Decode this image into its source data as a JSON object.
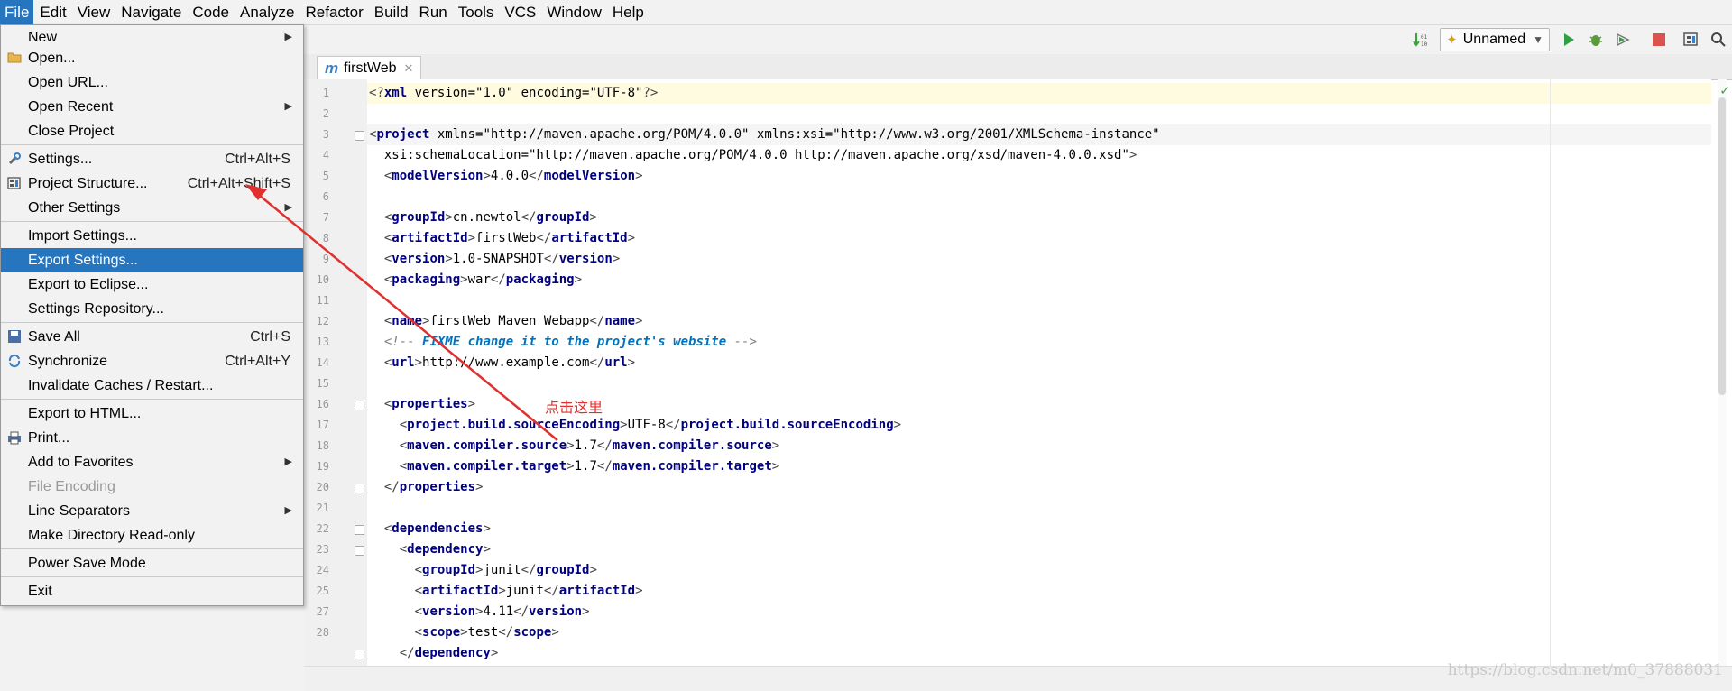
{
  "menubar": {
    "items": [
      "File",
      "Edit",
      "View",
      "Navigate",
      "Code",
      "Analyze",
      "Refactor",
      "Build",
      "Run",
      "Tools",
      "VCS",
      "Window",
      "Help"
    ]
  },
  "toolbar": {
    "run_config": "Unnamed",
    "icons": [
      "sort-icon",
      "run-icon",
      "debug-icon",
      "coverage-icon",
      "stop-icon",
      "project-structure-icon",
      "search-icon"
    ]
  },
  "file_menu": {
    "items": [
      {
        "label": "New",
        "shortcut": "",
        "submenu": true
      },
      {
        "label": "Open...",
        "shortcut": "",
        "icon": "folder"
      },
      {
        "label": "Open URL...",
        "shortcut": ""
      },
      {
        "label": "Open Recent",
        "shortcut": "",
        "submenu": true
      },
      {
        "label": "Close Project",
        "shortcut": ""
      },
      {
        "label": "Settings...",
        "shortcut": "Ctrl+Alt+S",
        "icon": "wrench"
      },
      {
        "label": "Project Structure...",
        "shortcut": "Ctrl+Alt+Shift+S",
        "icon": "structure"
      },
      {
        "label": "Other Settings",
        "shortcut": "",
        "submenu": true
      },
      {
        "label": "Import Settings...",
        "shortcut": ""
      },
      {
        "label": "Export Settings...",
        "shortcut": "",
        "selected": true
      },
      {
        "label": "Export to Eclipse...",
        "shortcut": ""
      },
      {
        "label": "Settings Repository...",
        "shortcut": ""
      },
      {
        "label": "Save All",
        "shortcut": "Ctrl+S",
        "icon": "save"
      },
      {
        "label": "Synchronize",
        "shortcut": "Ctrl+Alt+Y",
        "icon": "sync"
      },
      {
        "label": "Invalidate Caches / Restart...",
        "shortcut": ""
      },
      {
        "label": "Export to HTML...",
        "shortcut": ""
      },
      {
        "label": "Print...",
        "shortcut": "",
        "icon": "print"
      },
      {
        "label": "Add to Favorites",
        "shortcut": "",
        "submenu": true
      },
      {
        "label": "File Encoding",
        "shortcut": "",
        "disabled": true
      },
      {
        "label": "Line Separators",
        "shortcut": "",
        "submenu": true
      },
      {
        "label": "Make Directory Read-only",
        "shortcut": ""
      },
      {
        "label": "Power Save Mode",
        "shortcut": ""
      },
      {
        "label": "Exit",
        "shortcut": ""
      }
    ]
  },
  "editor": {
    "tab_label": "firstWeb",
    "line_numbers": [
      "1",
      "2",
      "3",
      "4",
      "5",
      "6",
      "7",
      "8",
      "9",
      "10",
      "11",
      "12",
      "13",
      "14",
      "15",
      "16",
      "17",
      "18",
      "19",
      "20",
      "21",
      "22",
      "23",
      "24",
      "25",
      "27",
      "28"
    ],
    "lines": [
      "<?xml version=\"1.0\" encoding=\"UTF-8\"?>",
      "",
      "<project xmlns=\"http://maven.apache.org/POM/4.0.0\" xmlns:xsi=\"http://www.w3.org/2001/XMLSchema-instance\"",
      "  xsi:schemaLocation=\"http://maven.apache.org/POM/4.0.0 http://maven.apache.org/xsd/maven-4.0.0.xsd\">",
      "  <modelVersion>4.0.0</modelVersion>",
      "",
      "  <groupId>cn.newtol</groupId>",
      "  <artifactId>firstWeb</artifactId>",
      "  <version>1.0-SNAPSHOT</version>",
      "  <packaging>war</packaging>",
      "",
      "  <name>firstWeb Maven Webapp</name>",
      "  <!-- FIXME change it to the project's website -->",
      "  <url>http://www.example.com</url>",
      "",
      "  <properties>",
      "    <project.build.sourceEncoding>UTF-8</project.build.sourceEncoding>",
      "    <maven.compiler.source>1.7</maven.compiler.source>",
      "    <maven.compiler.target>1.7</maven.compiler.target>",
      "  </properties>",
      "",
      "  <dependencies>",
      "    <dependency>",
      "      <groupId>junit</groupId>",
      "      <artifactId>junit</artifactId>",
      "      <version>4.11</version>",
      "      <scope>test</scope>",
      "    </dependency>"
    ]
  },
  "annotation": {
    "text": "点击这里",
    "color": "#e03030"
  },
  "watermark": "https://blog.csdn.net/m0_37888031",
  "colors": {
    "selection": "#2675bf",
    "tag": "#000080",
    "attr_name": "#0000ff",
    "attr_value": "#008000",
    "comment": "#808080"
  }
}
